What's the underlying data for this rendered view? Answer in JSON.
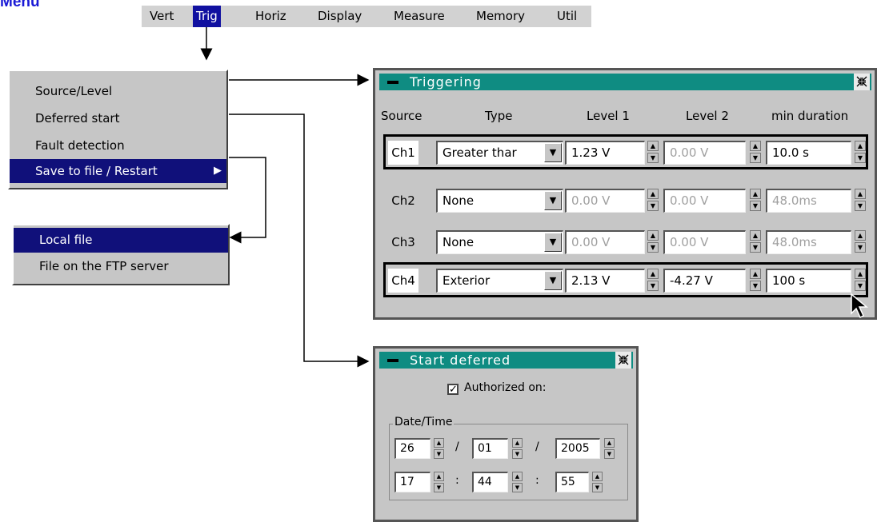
{
  "heading": "Menu",
  "menubar": {
    "items": [
      {
        "label": "Vert"
      },
      {
        "label": "Trig"
      },
      {
        "label": "Horiz"
      },
      {
        "label": "Display"
      },
      {
        "label": "Measure"
      },
      {
        "label": "Memory"
      },
      {
        "label": "Util"
      }
    ],
    "active": "Trig"
  },
  "trig_menu": {
    "items": [
      {
        "label": "Source/Level"
      },
      {
        "label": "Deferred start"
      },
      {
        "label": "Fault detection"
      },
      {
        "label": "Save to file / Restart"
      }
    ],
    "selected": "Save to file / Restart"
  },
  "save_submenu": {
    "items": [
      {
        "label": "Local file"
      },
      {
        "label": "File on the FTP server"
      }
    ],
    "selected": "Local file"
  },
  "triggering": {
    "title": "Triggering",
    "columns": {
      "source": "Source",
      "type": "Type",
      "level1": "Level 1",
      "level2": "Level 2",
      "min_duration": "min duration"
    },
    "rows": [
      {
        "source": "Ch1",
        "type": "Greater thar",
        "level1": "1.23 V",
        "level2": "0.00 V",
        "min_duration": "10.0 s"
      },
      {
        "source": "Ch2",
        "type": "None",
        "level1": "0.00 V",
        "level2": "0.00 V",
        "min_duration": "48.0ms"
      },
      {
        "source": "Ch3",
        "type": "None",
        "level1": "0.00 V",
        "level2": "0.00 V",
        "min_duration": "48.0ms"
      },
      {
        "source": "Ch4",
        "type": "Exterior",
        "level1": "2.13 V",
        "level2": "-4.27 V",
        "min_duration": "100 s"
      }
    ]
  },
  "deferred": {
    "title": "Start deferred",
    "authorized_label": "Authorized on:",
    "authorized_checked": true,
    "group_label": "Date/Time",
    "day": "26",
    "month": "01",
    "year": "2005",
    "hour": "17",
    "minute": "44",
    "second": "55",
    "date_sep": "/",
    "time_sep": ":"
  },
  "icons": {
    "spin_up": "▲",
    "spin_down": "▼",
    "dropdown": "▼",
    "submenu_arrow": "▶",
    "check": "✓",
    "shrink": "⌘"
  }
}
